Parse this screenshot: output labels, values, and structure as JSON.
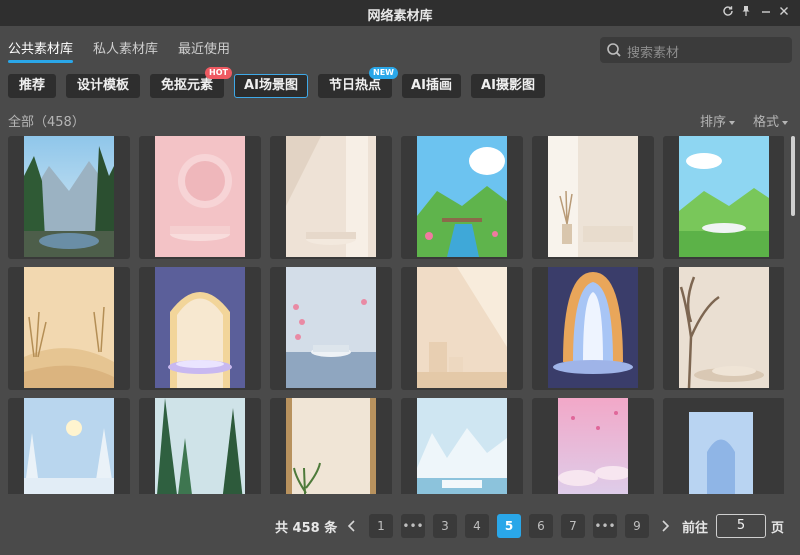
{
  "window": {
    "title": "网络素材库",
    "buttons": [
      "refresh-icon",
      "pin-icon",
      "minimize-icon",
      "close-icon"
    ]
  },
  "tabs": [
    {
      "label": "公共素材库",
      "active": true
    },
    {
      "label": "私人素材库",
      "active": false
    },
    {
      "label": "最近使用",
      "active": false
    }
  ],
  "search": {
    "placeholder": "搜索素材",
    "icon": "search-icon"
  },
  "categories": [
    {
      "label": "推荐",
      "active": false,
      "badge": ""
    },
    {
      "label": "设计模板",
      "active": false,
      "badge": ""
    },
    {
      "label": "免抠元素",
      "active": false,
      "badge": "HOT"
    },
    {
      "label": "AI场景图",
      "active": true,
      "badge": ""
    },
    {
      "label": "节日热点",
      "active": false,
      "badge": "NEW"
    },
    {
      "label": "AI插画",
      "active": false,
      "badge": ""
    },
    {
      "label": "AI摄影图",
      "active": false,
      "badge": ""
    }
  ],
  "summary": {
    "count_label": "全部（458）",
    "sort_label": "排序",
    "format_label": "格式"
  },
  "thumbnails": [
    {
      "name": "mountain-forest-lake"
    },
    {
      "name": "pink-podium-circle"
    },
    {
      "name": "beige-wall-podium"
    },
    {
      "name": "green-valley-stream"
    },
    {
      "name": "sunlit-room-vase"
    },
    {
      "name": "green-field-podium"
    },
    {
      "name": "desert-dunes-grass"
    },
    {
      "name": "neon-arch-podium"
    },
    {
      "name": "pink-flower-water-podium"
    },
    {
      "name": "beige-boxes-sunlight"
    },
    {
      "name": "glowing-light-curtain"
    },
    {
      "name": "tree-branch-podium"
    },
    {
      "name": "snowy-forest-sun"
    },
    {
      "name": "pine-forest-light"
    },
    {
      "name": "bamboo-frame-plant"
    },
    {
      "name": "ice-mountain-podium"
    },
    {
      "name": "pink-sky-petals"
    },
    {
      "name": "blue-arch-podium"
    }
  ],
  "pagination": {
    "total_label": "共 458 条",
    "pages": [
      "1",
      "•••",
      "3",
      "4",
      "5",
      "6",
      "7",
      "•••",
      "9"
    ],
    "current": "5",
    "goto_label": "前往",
    "goto_value": "5",
    "page_unit": "页"
  },
  "colors": {
    "accent": "#2aa7e9",
    "hot": "#ef5a62",
    "background": "#4a4a4a",
    "titlebar": "#2f2f2f"
  }
}
